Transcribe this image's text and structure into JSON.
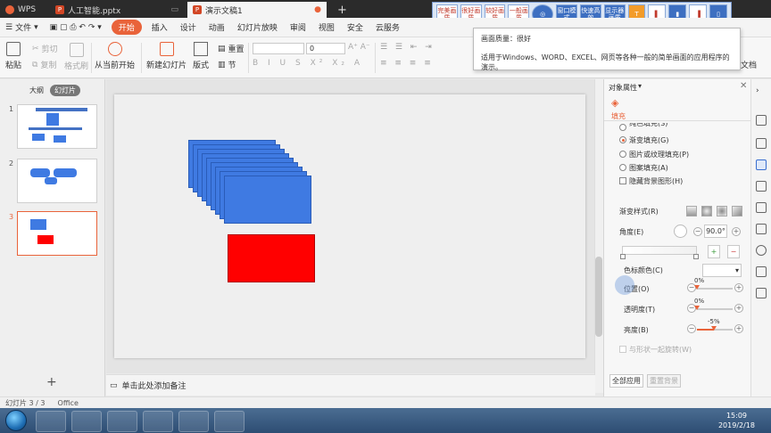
{
  "titlebar": {
    "app_label": "WPS",
    "tabs": [
      {
        "label": "人工智能.pptx",
        "icon": "ppt-icon"
      },
      {
        "label": "演示文稿1",
        "icon": "ppt-icon"
      }
    ],
    "new_tab": "+"
  },
  "floatbar": {
    "buttons": [
      "完美画质",
      "很好画质",
      "较好画质",
      "一般画质",
      "窗口模式",
      "快速高效",
      "显示器画质"
    ]
  },
  "tooltip": {
    "title": "画面质量：很好",
    "body": "适用于Windows、WORD、EXCEL、网页等各种一般的简单画面的应用程序的演示。"
  },
  "menubar": {
    "file": "文件",
    "items": [
      "开始",
      "插入",
      "设计",
      "动画",
      "幻灯片放映",
      "审阅",
      "视图",
      "安全",
      "云服务"
    ]
  },
  "ribbon": {
    "paste": "粘贴",
    "cut": "剪切",
    "copy": "复制",
    "format_painter": "格式刷",
    "from_current": "从当前开始",
    "new_slide": "新建幻灯片",
    "layout": "版式",
    "section": "节",
    "reset": "重置",
    "font_size": "0",
    "doc_label": "文档"
  },
  "leftpanel": {
    "tabs": [
      "大纲",
      "幻灯片"
    ],
    "slides": [
      "1",
      "2",
      "3"
    ],
    "add": "+"
  },
  "notes": {
    "placeholder": "单击此处添加备注"
  },
  "rightpanel": {
    "title": "对象属性",
    "tab_fill": "填充",
    "options": {
      "solid": "纯色填充(S)",
      "gradient": "渐变填充(G)",
      "picture": "图片或纹理填充(P)",
      "pattern": "图案填充(A)",
      "hide_bg": "隐藏背景图形(H)"
    },
    "gradient_style": "渐变样式(R)",
    "angle_label": "角度(E)",
    "angle_value": "90.0°",
    "stop_color_label": "色标颜色(C)",
    "position_label": "位置(O)",
    "position_value": "0%",
    "position_fraction": 0,
    "transparency_label": "透明度(T)",
    "transparency_value": "0%",
    "transparency_fraction": 0,
    "brightness_label": "亮度(B)",
    "brightness_value": "-5%",
    "brightness_fraction": 0.475,
    "rotate_with_shape": "与形状一起旋转(W)",
    "apply_all": "全部应用",
    "reset_bg": "重置背景"
  },
  "statusbar": {
    "slide_info": "幻灯片 3 / 3",
    "theme": "Office"
  },
  "taskbar": {
    "time": "15:09",
    "date": "2019/2/18"
  },
  "colors": {
    "accent": "#e9633a",
    "shape_blue": "#3f7ae2",
    "shape_red": "#ff0000"
  }
}
